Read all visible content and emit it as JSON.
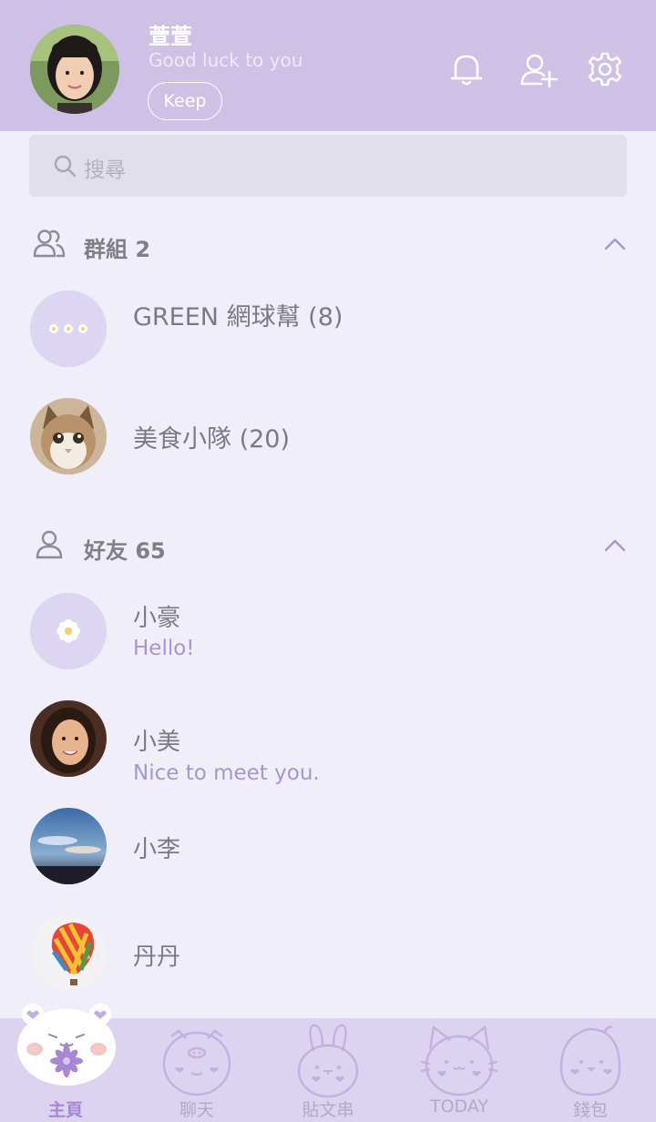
{
  "header": {
    "name": "萱萱",
    "status": "Good luck to you",
    "keep_label": "Keep",
    "icons": [
      "bell-icon",
      "add-friend-icon",
      "settings-icon"
    ]
  },
  "search": {
    "placeholder": "搜尋"
  },
  "groups": {
    "label": "群組 2",
    "items": [
      {
        "name": "GREEN 網球幫 (8)",
        "avatar": "flowers-avatar"
      },
      {
        "name": "美食小隊 (20)",
        "avatar": "cat-photo-avatar"
      }
    ]
  },
  "friends": {
    "label": "好友 65",
    "items": [
      {
        "name": "小豪",
        "message": "Hello!",
        "avatar": "flower-avatar"
      },
      {
        "name": "小美",
        "message": "Nice to meet you.",
        "avatar": "woman-photo-avatar"
      },
      {
        "name": "小李",
        "message": "",
        "avatar": "sky-photo-avatar"
      },
      {
        "name": "丹丹",
        "message": "",
        "avatar": "balloon-photo-avatar"
      }
    ]
  },
  "tabs": [
    {
      "label": "主頁",
      "icon": "bear-icon",
      "active": true
    },
    {
      "label": "聊天",
      "icon": "pig-icon",
      "active": false
    },
    {
      "label": "貼文串",
      "icon": "rabbit-icon",
      "active": false
    },
    {
      "label": "TODAY",
      "icon": "cat-icon",
      "active": false
    },
    {
      "label": "錢包",
      "icon": "chick-icon",
      "active": false
    }
  ],
  "colors": {
    "header_bg": "#cfc0e6",
    "body_bg": "#f0eef8",
    "accent": "#a786d4",
    "tabbar_bg": "#dcd3f0"
  }
}
